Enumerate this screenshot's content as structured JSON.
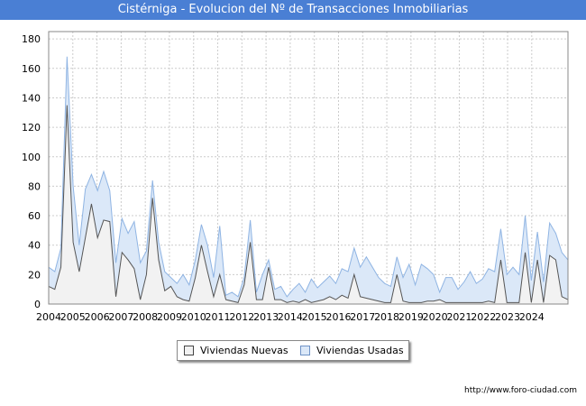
{
  "header": {
    "title": "Cistérniga - Evolucion del Nº de Transacciones Inmobiliarias"
  },
  "footer": {
    "url": "http://www.foro-ciudad.com"
  },
  "colors": {
    "title_bar": "#4a7fd4",
    "nuevas_fill": "#f2f2f2",
    "nuevas_line": "#555555",
    "usadas_fill": "#dbe8f8",
    "usadas_line": "#8fb4e3",
    "grid": "#cccccc"
  },
  "chart_data": {
    "type": "area",
    "title": "Cistérniga - Evolucion del Nº de Transacciones Inmobiliarias",
    "xlabel": "",
    "ylabel": "",
    "ylim": [
      0,
      185
    ],
    "yticks": [
      0,
      20,
      40,
      60,
      80,
      100,
      120,
      140,
      160,
      180
    ],
    "xticks": [
      "2004",
      "2005",
      "2006",
      "2007",
      "2008",
      "2009",
      "2010",
      "2011",
      "2012",
      "2013",
      "2014",
      "2015",
      "2016",
      "2017",
      "2018",
      "2019",
      "2020",
      "2021",
      "2022",
      "2023",
      "2024"
    ],
    "grid": true,
    "legend_position": "bottom",
    "x_start": "2004 Q1",
    "x_step": "quarter",
    "series": [
      {
        "name": "Viviendas Nuevas",
        "values": [
          12,
          10,
          25,
          135,
          42,
          22,
          45,
          68,
          45,
          57,
          56,
          5,
          35,
          30,
          24,
          3,
          20,
          72,
          30,
          9,
          12,
          5,
          3,
          2,
          18,
          40,
          22,
          5,
          20,
          3,
          2,
          1,
          13,
          42,
          3,
          3,
          25,
          3,
          3,
          1,
          2,
          1,
          3,
          1,
          2,
          3,
          5,
          3,
          6,
          4,
          20,
          5,
          4,
          3,
          2,
          1,
          1,
          20,
          2,
          1,
          1,
          1,
          2,
          2,
          3,
          1,
          1,
          1,
          1,
          1,
          1,
          1,
          2,
          1,
          30,
          1,
          1,
          1,
          35,
          1,
          30,
          1,
          33,
          30,
          5,
          3
        ]
      },
      {
        "name": "Viviendas Usadas",
        "values": [
          25,
          22,
          38,
          168,
          80,
          40,
          78,
          88,
          77,
          90,
          77,
          28,
          58,
          48,
          56,
          28,
          36,
          84,
          42,
          22,
          18,
          14,
          20,
          13,
          30,
          54,
          40,
          18,
          53,
          6,
          8,
          5,
          18,
          57,
          8,
          20,
          30,
          10,
          12,
          5,
          10,
          14,
          8,
          17,
          11,
          15,
          19,
          14,
          24,
          22,
          38,
          25,
          32,
          25,
          18,
          14,
          12,
          32,
          18,
          27,
          13,
          27,
          24,
          20,
          8,
          18,
          18,
          10,
          15,
          22,
          14,
          17,
          24,
          22,
          51,
          20,
          25,
          20,
          60,
          16,
          49,
          15,
          55,
          48,
          35,
          30
        ]
      }
    ]
  }
}
